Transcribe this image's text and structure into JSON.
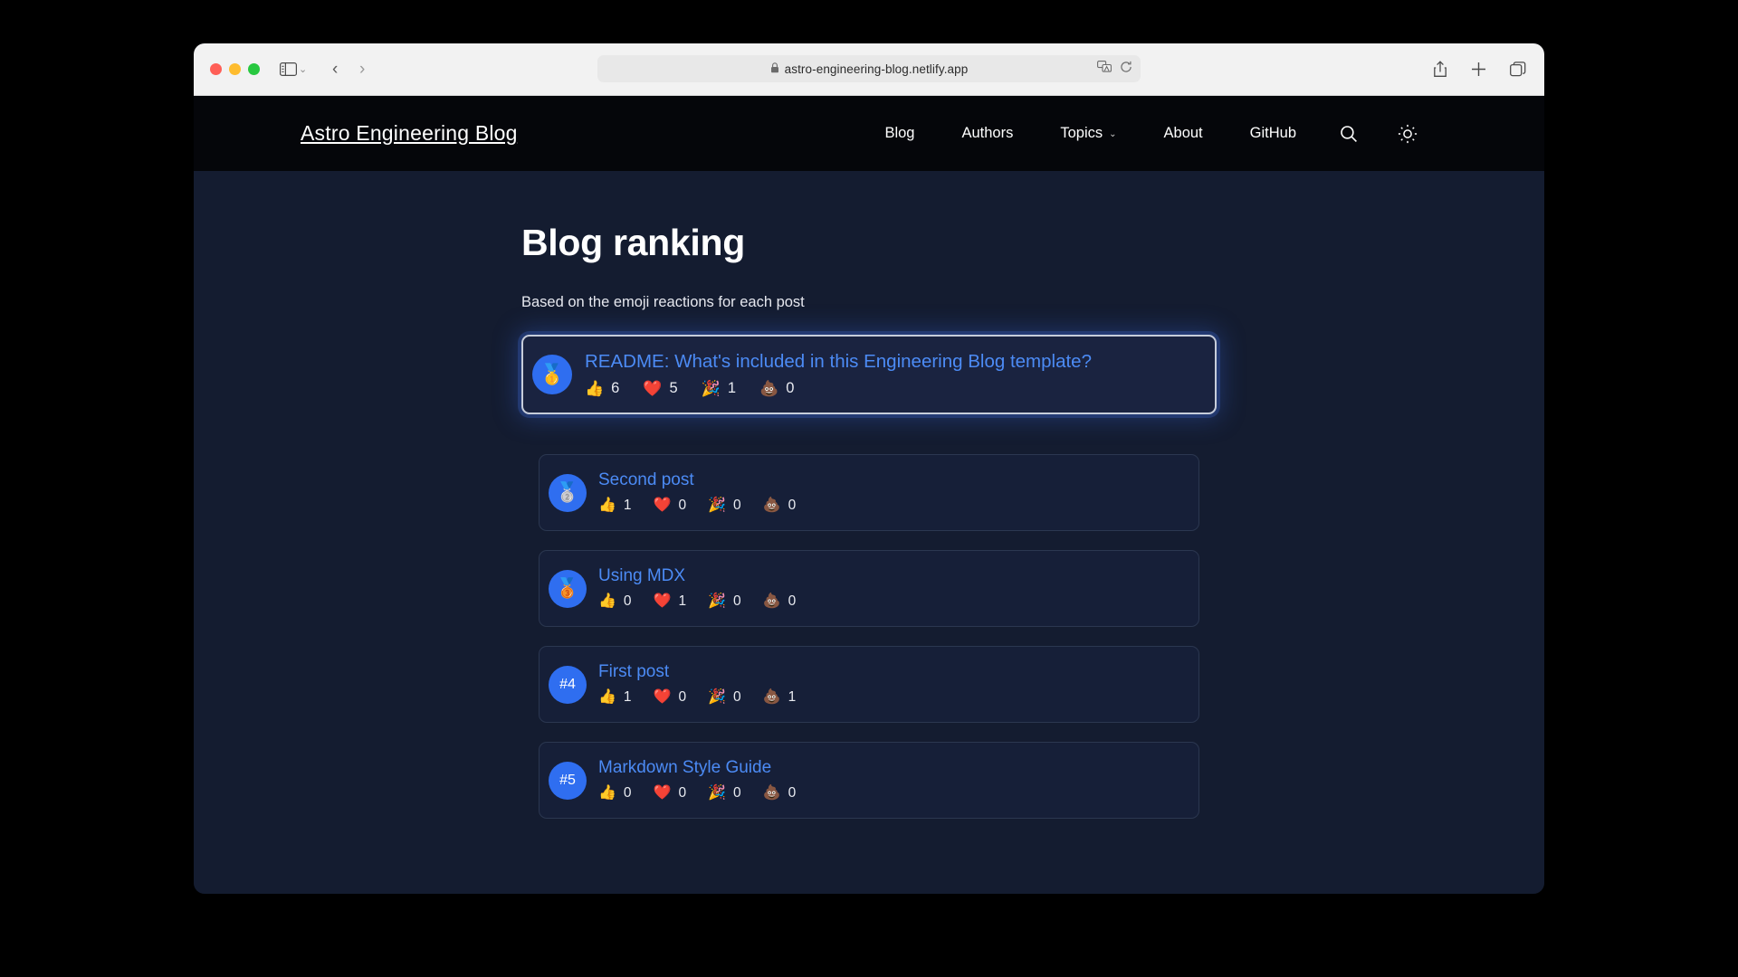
{
  "browser": {
    "url": "astro-engineering-blog.netlify.app",
    "lock_icon": "lock-icon",
    "sidebar_icon": "sidebar-toggle-icon",
    "back_icon": "back-arrow-icon",
    "forward_icon": "forward-arrow-icon",
    "translate_icon": "translate-icon",
    "reload_icon": "reload-icon",
    "share_icon": "share-icon",
    "newtab_icon": "plus-icon",
    "tabs_icon": "tab-overview-icon"
  },
  "site": {
    "brand": "Astro Engineering Blog",
    "nav": [
      {
        "label": "Blog",
        "has_chevron": false
      },
      {
        "label": "Authors",
        "has_chevron": false
      },
      {
        "label": "Topics",
        "has_chevron": true
      },
      {
        "label": "About",
        "has_chevron": false
      },
      {
        "label": "GitHub",
        "has_chevron": false
      }
    ],
    "search_icon": "search-icon",
    "theme_icon": "sun-icon"
  },
  "main": {
    "title": "Blog ranking",
    "subtitle": "Based on the emoji reactions for each post"
  },
  "ranking": [
    {
      "rank_badge": "🥇",
      "badge_type": "medal",
      "title": "README: What's included in this Engineering Blog template?",
      "reactions": [
        {
          "emoji": "👍",
          "name": "thumbsup-reaction",
          "count": "6"
        },
        {
          "emoji": "❤️",
          "name": "heart-reaction",
          "count": "5"
        },
        {
          "emoji": "🎉",
          "name": "party-reaction",
          "count": "1"
        },
        {
          "emoji": "💩",
          "name": "poop-reaction",
          "count": "0"
        }
      ]
    },
    {
      "rank_badge": "🥈",
      "badge_type": "medal",
      "title": "Second post",
      "reactions": [
        {
          "emoji": "👍",
          "name": "thumbsup-reaction",
          "count": "1"
        },
        {
          "emoji": "❤️",
          "name": "heart-reaction",
          "count": "0"
        },
        {
          "emoji": "🎉",
          "name": "party-reaction",
          "count": "0"
        },
        {
          "emoji": "💩",
          "name": "poop-reaction",
          "count": "0"
        }
      ]
    },
    {
      "rank_badge": "🥉",
      "badge_type": "medal",
      "title": "Using MDX",
      "reactions": [
        {
          "emoji": "👍",
          "name": "thumbsup-reaction",
          "count": "0"
        },
        {
          "emoji": "❤️",
          "name": "heart-reaction",
          "count": "1"
        },
        {
          "emoji": "🎉",
          "name": "party-reaction",
          "count": "0"
        },
        {
          "emoji": "💩",
          "name": "poop-reaction",
          "count": "0"
        }
      ]
    },
    {
      "rank_badge": "#4",
      "badge_type": "number",
      "title": "First post",
      "reactions": [
        {
          "emoji": "👍",
          "name": "thumbsup-reaction",
          "count": "1"
        },
        {
          "emoji": "❤️",
          "name": "heart-reaction",
          "count": "0"
        },
        {
          "emoji": "🎉",
          "name": "party-reaction",
          "count": "0"
        },
        {
          "emoji": "💩",
          "name": "poop-reaction",
          "count": "1"
        }
      ]
    },
    {
      "rank_badge": "#5",
      "badge_type": "number",
      "title": "Markdown Style Guide",
      "reactions": [
        {
          "emoji": "👍",
          "name": "thumbsup-reaction",
          "count": "0"
        },
        {
          "emoji": "❤️",
          "name": "heart-reaction",
          "count": "0"
        },
        {
          "emoji": "🎉",
          "name": "party-reaction",
          "count": "0"
        },
        {
          "emoji": "💩",
          "name": "poop-reaction",
          "count": "0"
        }
      ]
    }
  ],
  "colors": {
    "page_bg": "#141c30",
    "header_bg": "#05060a",
    "card_bg": "#161f38",
    "link": "#4c8bf5",
    "badge": "#2f6ef0",
    "highlight_border": "#c7cdda"
  }
}
